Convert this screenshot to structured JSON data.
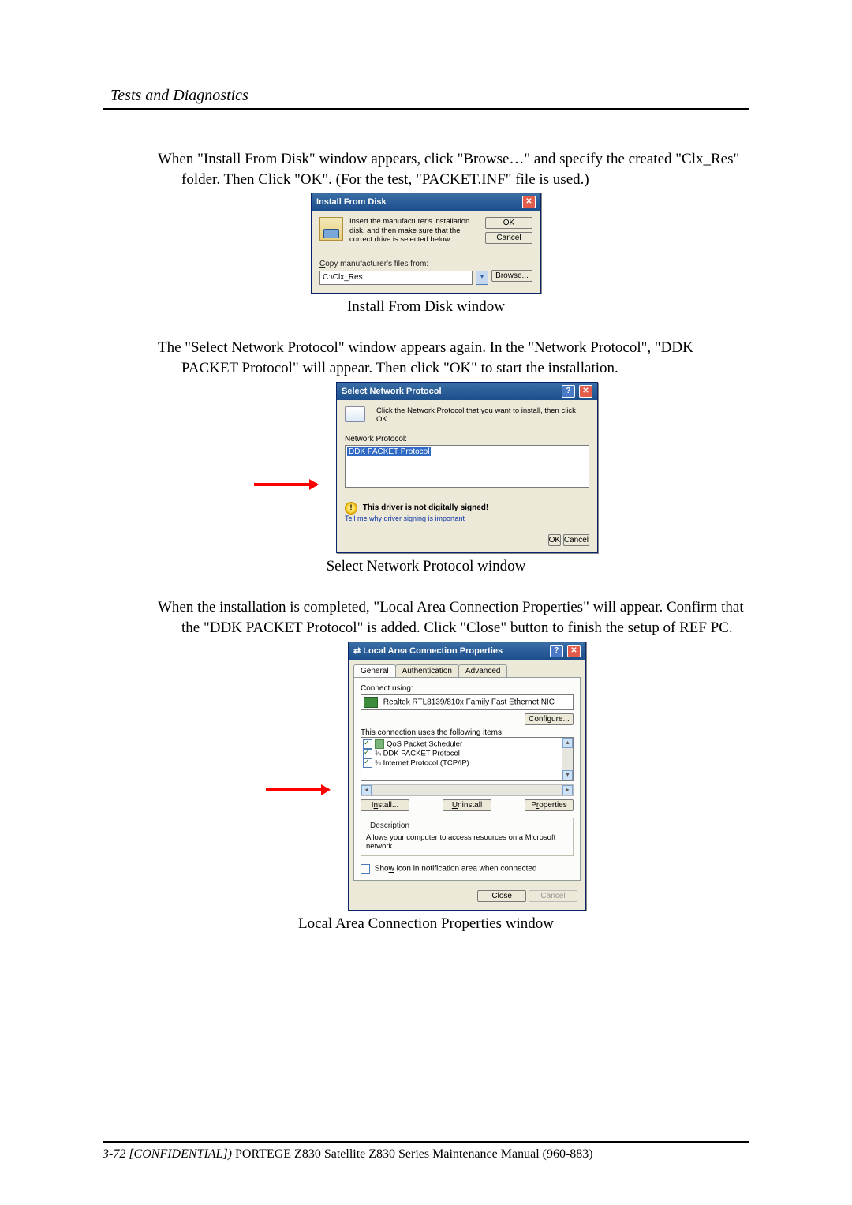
{
  "header": {
    "section": "Tests and Diagnostics"
  },
  "para1": "When \"Install From Disk\" window appears, click \"Browse…\" and specify the created \"Clx_Res\" folder. Then Click \"OK\". (For the test, \"PACKET.INF\" file is used.)",
  "caption1": "Install From Disk window",
  "para2": "The \"Select Network Protocol\" window appears again. In the \"Network Protocol\", \"DDK PACKET Protocol\" will appear. Then click \"OK\" to start the installation.",
  "caption2": "Select Network Protocol window",
  "para3": "When the installation is completed, \"Local Area Connection Properties\" will appear. Confirm that the \"DDK PACKET Protocol\" is added. Click \"Close\" button to finish the setup of REF PC.",
  "caption3": "Local Area Connection Properties window",
  "dlg1": {
    "title": "Install From Disk",
    "msg": "Insert the manufacturer's installation disk, and then make sure that the correct drive is selected below.",
    "ok": "OK",
    "cancel": "Cancel",
    "copyfrom": "Copy manufacturer's files from:",
    "path": "C:\\Clx_Res",
    "browse": "Browse..."
  },
  "dlg2": {
    "title": "Select Network Protocol",
    "msg": "Click the Network Protocol that you want to install, then click OK.",
    "label": "Network Protocol:",
    "item": "DDK PACKET Protocol",
    "warn": "This driver is not digitally signed!",
    "link": "Tell me why driver signing is important",
    "ok": "OK",
    "cancel": "Cancel"
  },
  "dlg3": {
    "title": "Local Area Connection Properties",
    "tabs": {
      "general": "General",
      "auth": "Authentication",
      "adv": "Advanced"
    },
    "connect_using": "Connect using:",
    "nic": "Realtek RTL8139/810x Family Fast Ethernet NIC",
    "configure": "Configure...",
    "uses": "This connection uses the following items:",
    "items": {
      "a": "QoS Packet Scheduler",
      "b": "DDK PACKET Protocol",
      "c": "Internet Protocol (TCP/IP)"
    },
    "install": "Install...",
    "uninstall": "Uninstall",
    "properties": "Properties",
    "desc_title": "Description",
    "desc": "Allows your computer to access resources on a Microsoft network.",
    "showicon": "Show icon in notification area when connected",
    "close": "Close",
    "cancel": "Cancel"
  },
  "footer": {
    "left_em": "3-72 [CONFIDENTIAL])",
    "rest": " PORTEGE Z830 Satellite Z830 Series Maintenance Manual (960-883)"
  }
}
